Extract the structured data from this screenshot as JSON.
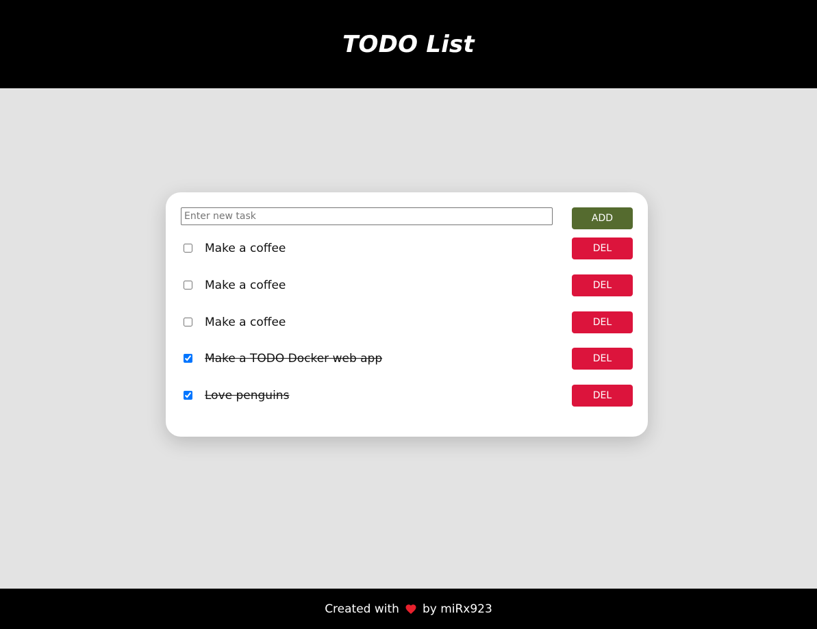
{
  "header": {
    "title": "TODO List"
  },
  "form": {
    "placeholder": "Enter new task",
    "value": "",
    "add_label": "ADD"
  },
  "tasks": [
    {
      "text": "Make a coffee",
      "done": false,
      "delete_label": "DEL"
    },
    {
      "text": "Make a coffee",
      "done": false,
      "delete_label": "DEL"
    },
    {
      "text": "Make a coffee",
      "done": false,
      "delete_label": "DEL"
    },
    {
      "text": "Make a TODO Docker web app",
      "done": true,
      "delete_label": "DEL"
    },
    {
      "text": "Love penguins",
      "done": true,
      "delete_label": "DEL"
    }
  ],
  "footer": {
    "prefix": "Created with",
    "icon": "heart-icon",
    "suffix": "by miRx923"
  },
  "colors": {
    "header_bg": "#000000",
    "page_bg": "#e3e3e3",
    "add_button": "#556b2f",
    "delete_button": "#dc143c",
    "heart": "#e8212d"
  }
}
